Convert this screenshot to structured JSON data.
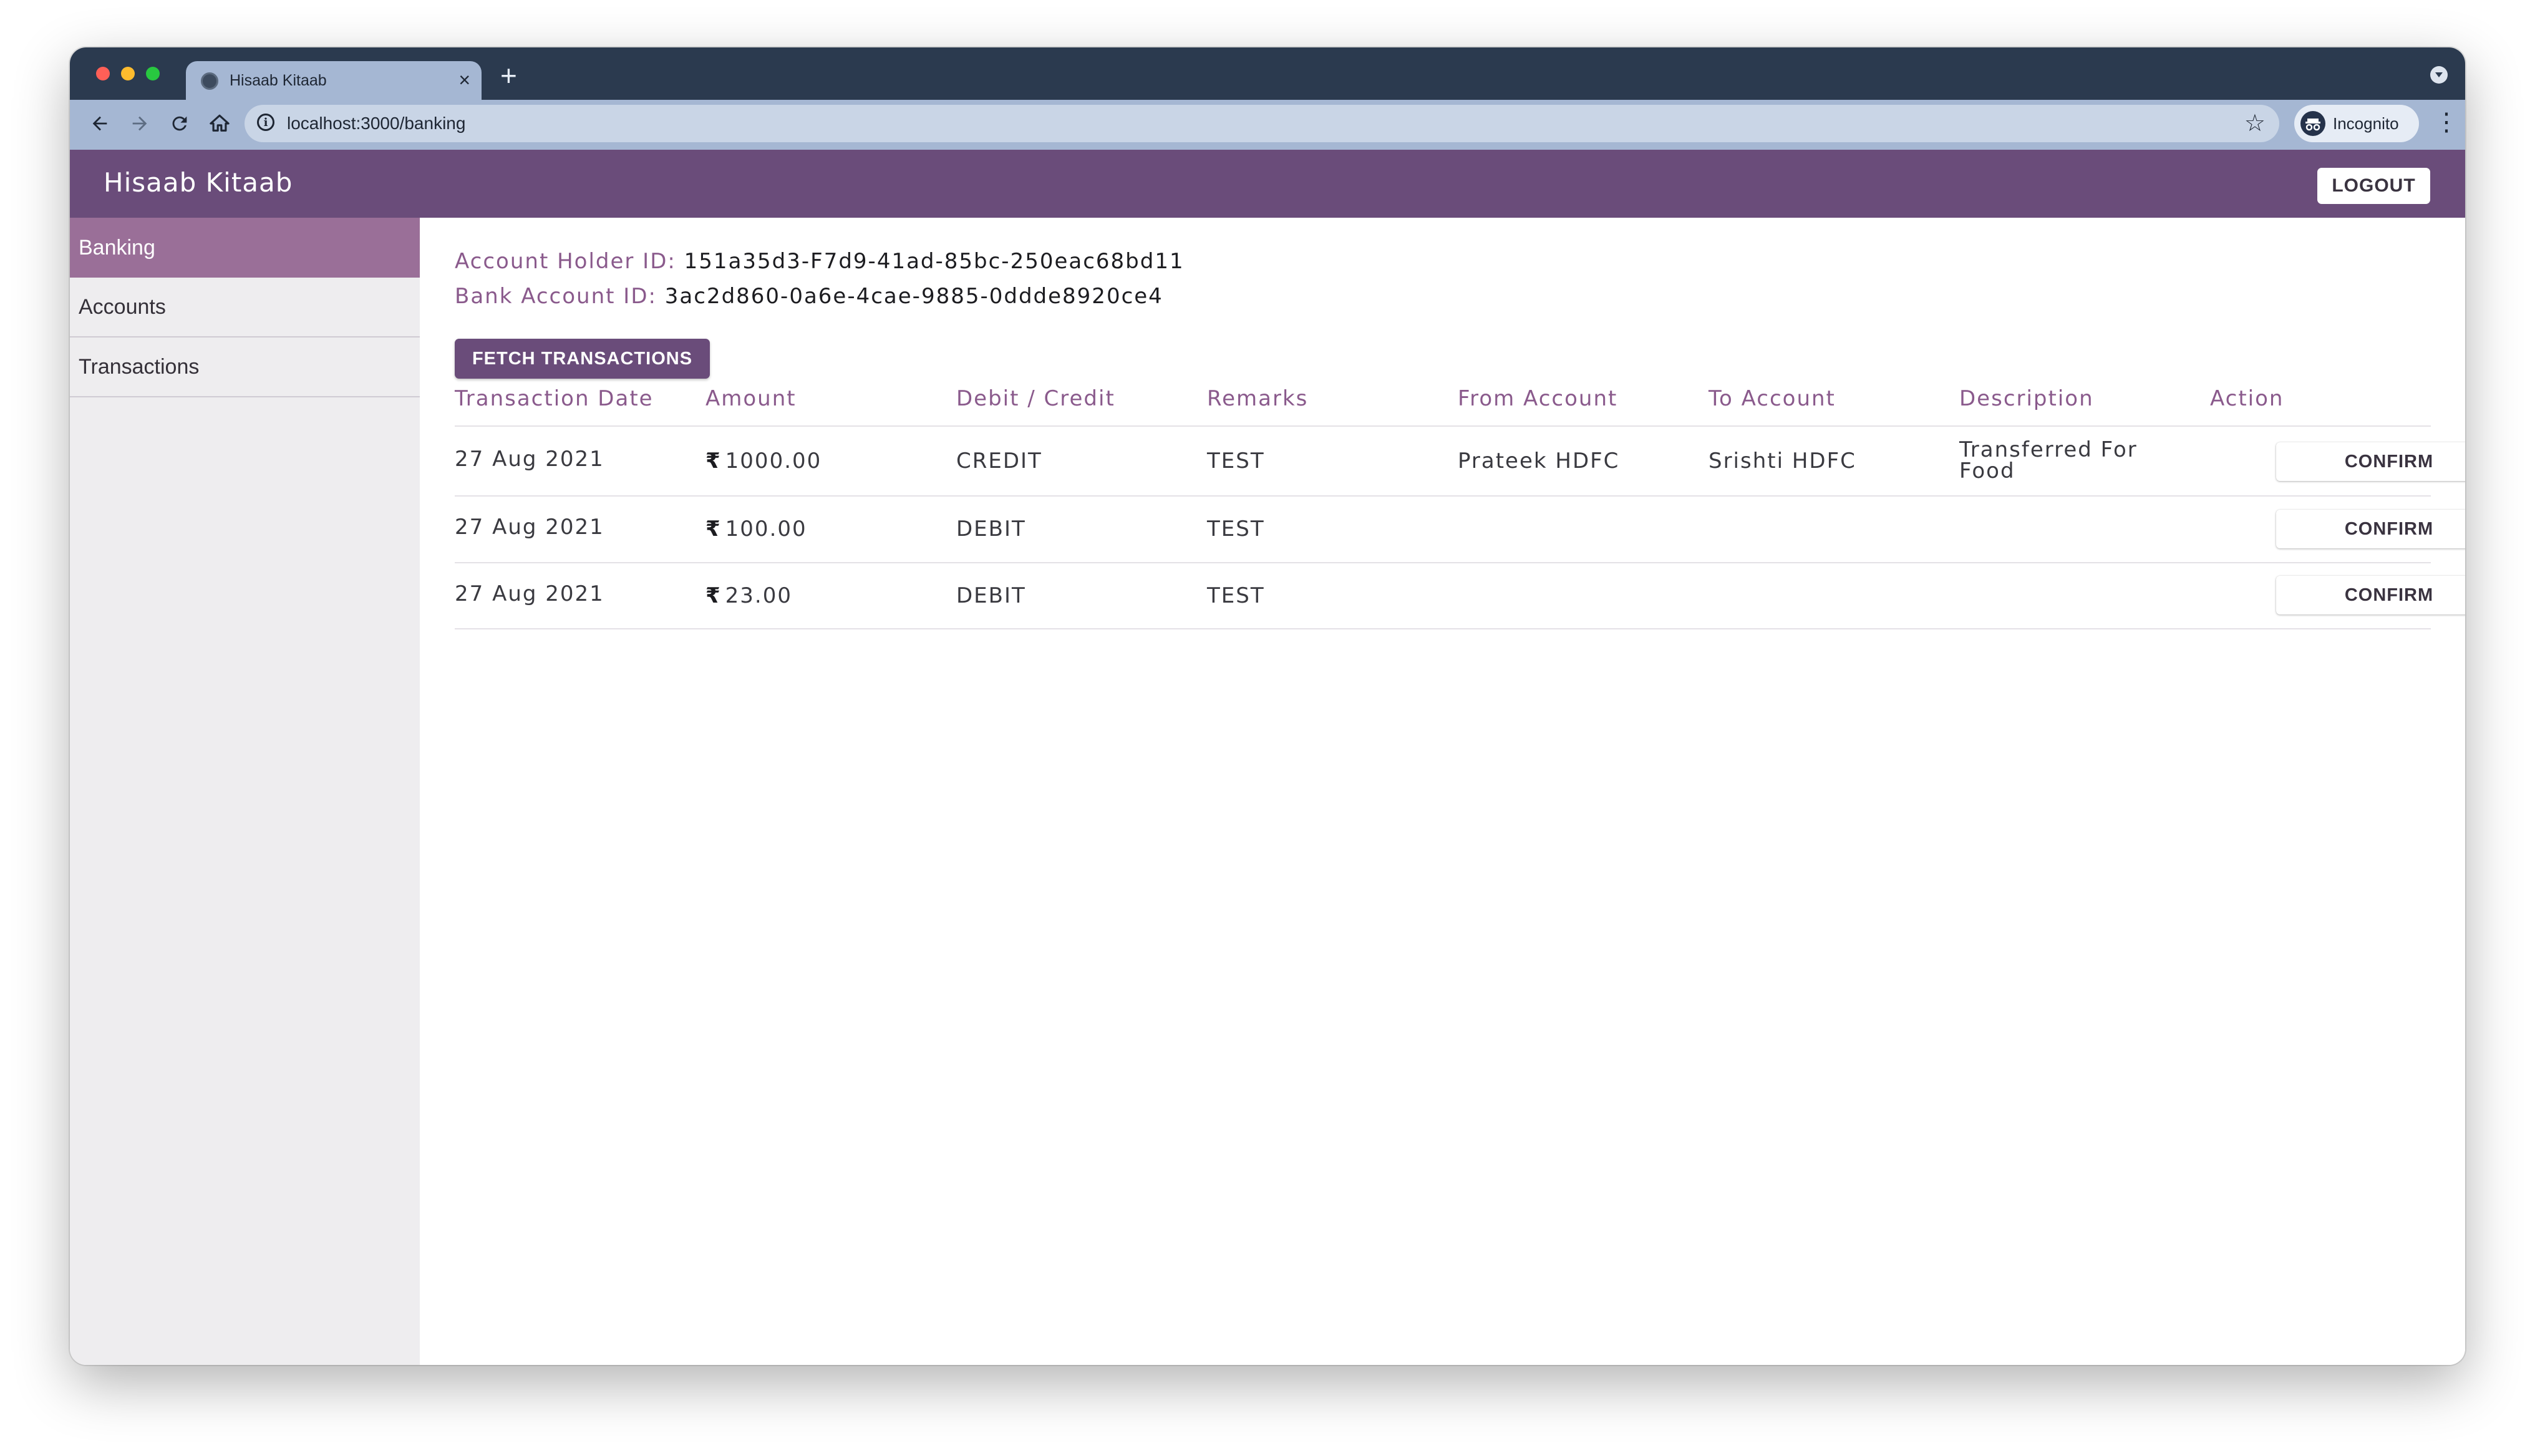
{
  "browser": {
    "tab_title": "Hisaab Kitaab",
    "tab_close": "×",
    "new_tab": "+",
    "url": "localhost:3000/banking",
    "profile_label": "Incognito",
    "icons": {
      "back": "arrow-left",
      "forward": "arrow-right",
      "reload": "reload",
      "home": "home",
      "info": "info",
      "bookmark": "star",
      "menu": "kebab"
    }
  },
  "app": {
    "title": "Hisaab Kitaab",
    "logout_label": "LOGOUT",
    "brand_color": "#6a4c7a"
  },
  "sidebar": {
    "items": [
      {
        "label": "Banking",
        "active": true
      },
      {
        "label": "Accounts",
        "active": false
      },
      {
        "label": "Transactions",
        "active": false
      }
    ]
  },
  "account": {
    "holder_label": "Account Holder ID:",
    "holder_id": "151a35d3-F7d9-41ad-85bc-250eac68bd11",
    "bank_label": "Bank Account ID:",
    "bank_id": "3ac2d860-0a6e-4cae-9885-0ddde8920ce4"
  },
  "fetch_label": "FETCH TRANSACTIONS",
  "table": {
    "columns": [
      "Transaction Date",
      "Amount",
      "Debit / Credit",
      "Remarks",
      "From Account",
      "To Account",
      "Description",
      "Action"
    ],
    "currency_symbol": "₹",
    "rows": [
      {
        "date": "27 Aug 2021",
        "amount": "1000.00",
        "type": "CREDIT",
        "remarks": "TEST",
        "from": "Prateek HDFC",
        "to": "Srishti HDFC",
        "description": "Transferred For Food",
        "action": "CONFIRM"
      },
      {
        "date": "27 Aug 2021",
        "amount": "100.00",
        "type": "DEBIT",
        "remarks": "TEST",
        "from": "",
        "to": "",
        "description": "",
        "action": "CONFIRM"
      },
      {
        "date": "27 Aug 2021",
        "amount": "23.00",
        "type": "DEBIT",
        "remarks": "TEST",
        "from": "",
        "to": "",
        "description": "",
        "action": "CONFIRM"
      }
    ]
  }
}
